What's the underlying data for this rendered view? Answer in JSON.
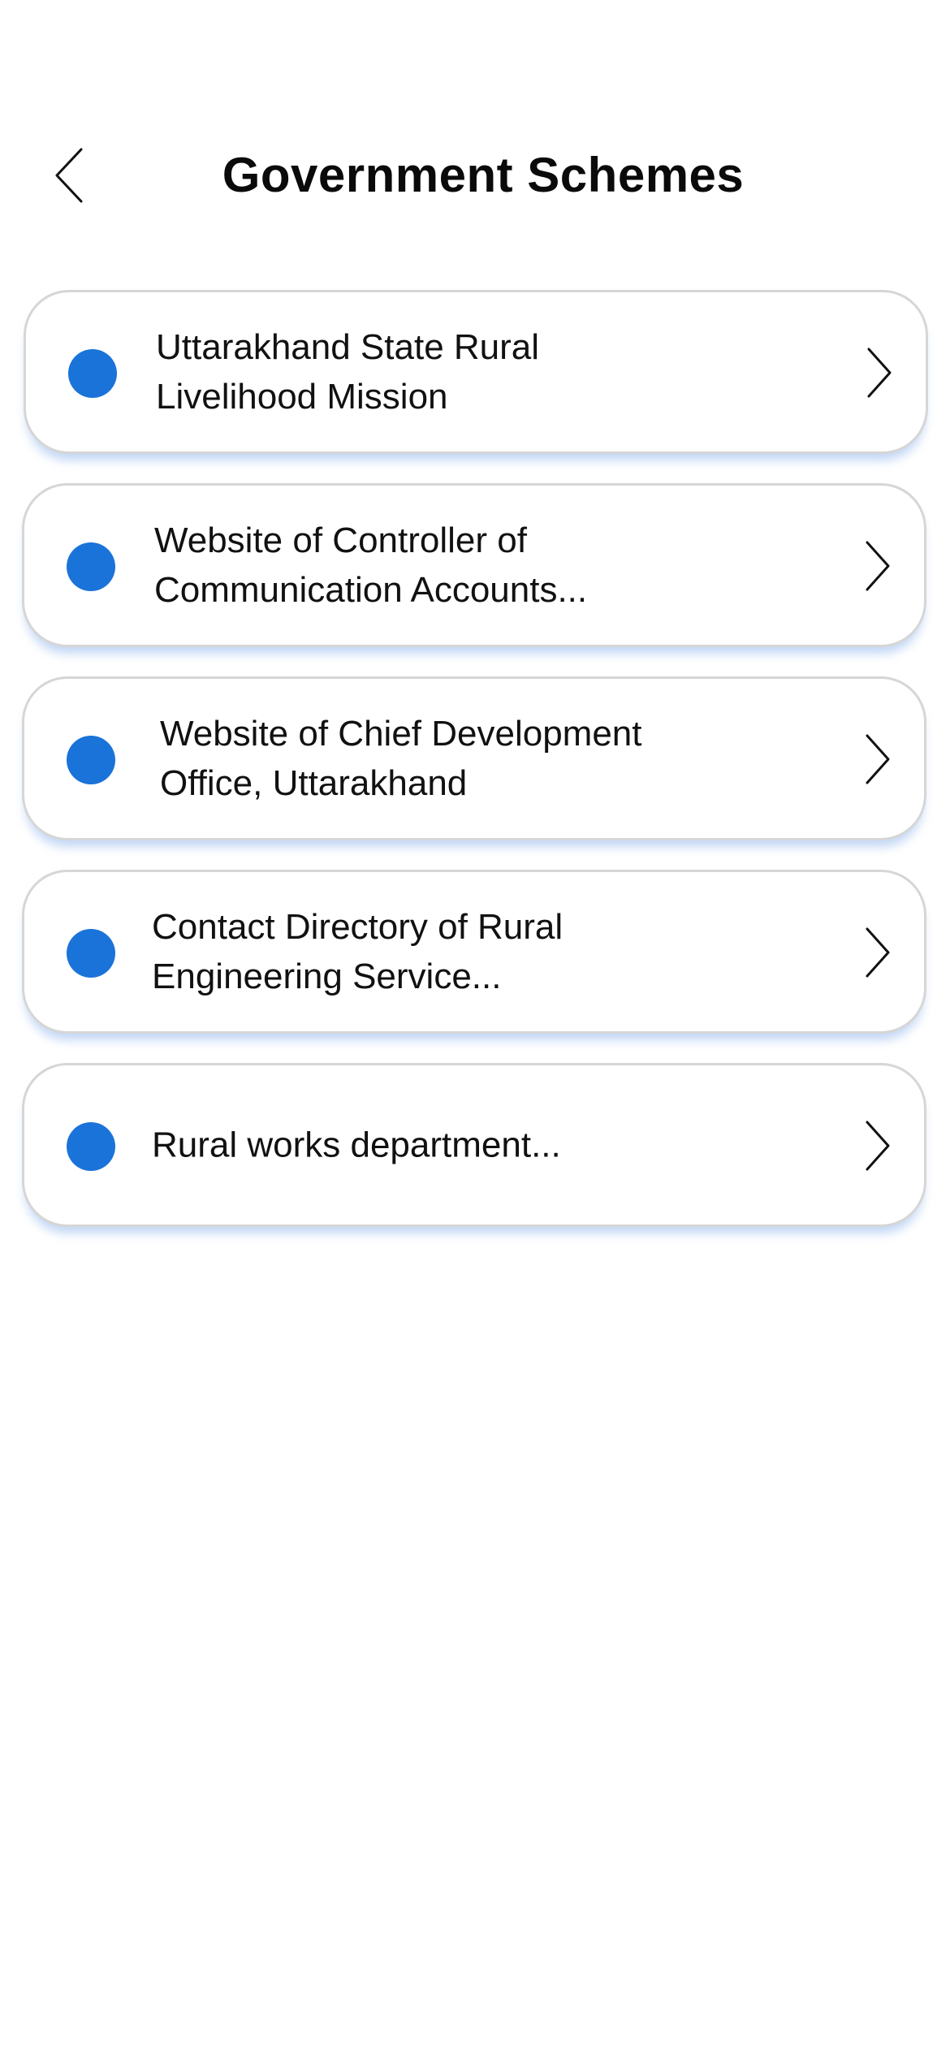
{
  "header": {
    "title": "Government Schemes",
    "back_icon": "chevron-left-icon"
  },
  "accent_color": "#1a73d9",
  "schemes": [
    {
      "label": "Uttarakhand State Rural\nLivelihood Mission"
    },
    {
      "label": "Website of Controller of\nCommunication Accounts..."
    },
    {
      "label": "Website of Chief Development\nOffice, Uttarakhand"
    },
    {
      "label": "Contact Directory of Rural\nEngineering Service..."
    },
    {
      "label": "Rural works department..."
    }
  ],
  "item_icons": {
    "bullet": "blue-dot-icon",
    "arrow": "chevron-right-icon"
  }
}
